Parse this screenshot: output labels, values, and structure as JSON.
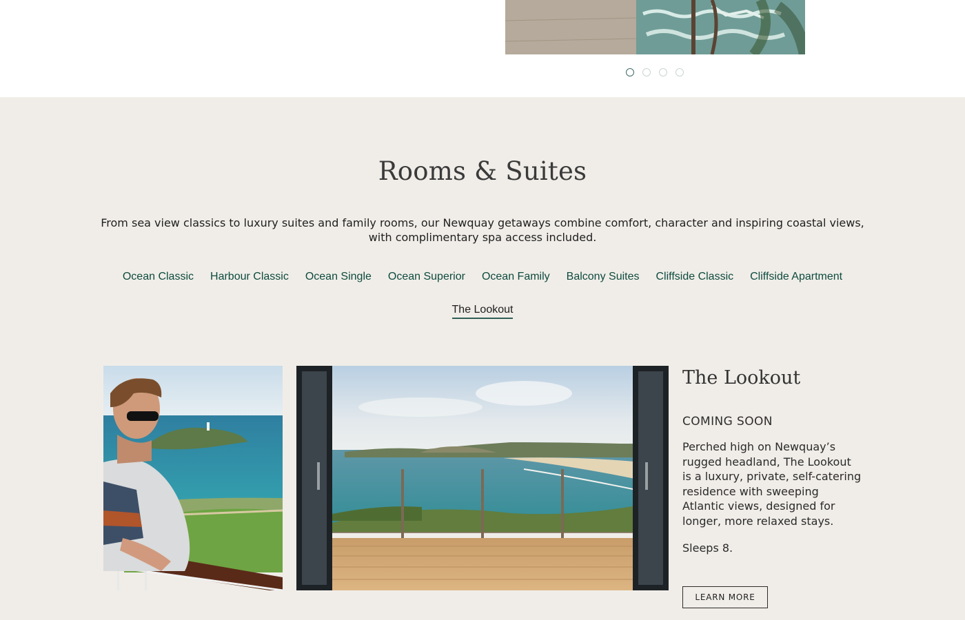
{
  "carousel": {
    "dots": [
      {
        "label": "slide-1",
        "active": true
      },
      {
        "label": "slide-2",
        "active": false
      },
      {
        "label": "slide-3",
        "active": false
      },
      {
        "label": "slide-4",
        "active": false
      }
    ]
  },
  "rooms": {
    "title": "Rooms & Suites",
    "intro_line1": "From sea view classics to luxury suites and family rooms, our Newquay getaways combine comfort, character and inspiring coastal views,",
    "intro_line2": "with complimentary spa access included.",
    "tabs": [
      "Ocean Classic",
      "Harbour Classic",
      "Ocean Single",
      "Ocean Superior",
      "Ocean Family",
      "Balcony Suites",
      "Cliffside Classic",
      "Cliffside Apartment"
    ],
    "active_tab": "The Lookout"
  },
  "detail": {
    "title": "The Lookout",
    "status": "COMING SOON",
    "desc_lines": [
      "Perched high on Newquay’s",
      "rugged headland, The Lookout",
      "is a luxury, private, self-catering",
      "residence with sweeping",
      "Atlantic views, designed for",
      "longer, more relaxed stays."
    ],
    "sleeps": "Sleeps 8.",
    "button": "LEARN MORE"
  },
  "colors": {
    "section_bg": "#f0ede8",
    "tab_link": "#0d4a3e",
    "active_underline": "#2f5e55"
  }
}
